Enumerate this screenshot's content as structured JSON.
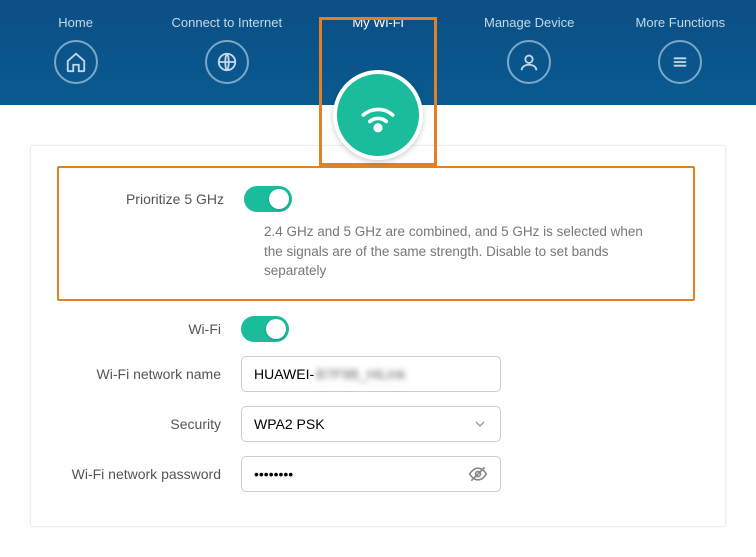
{
  "nav": {
    "home": "Home",
    "connect": "Connect to Internet",
    "wifi": "My Wi-Fi",
    "manage": "Manage Device",
    "more": "More Functions"
  },
  "form": {
    "prioritize_label": "Prioritize 5 GHz",
    "prioritize_desc": "2.4 GHz and 5 GHz are combined, and 5 GHz is selected when the signals are of the same strength. Disable to set bands separately",
    "wifi_label": "Wi-Fi",
    "ssid_label": "Wi-Fi network name",
    "ssid_value": "HUAWEI-",
    "ssid_hidden": "B7F9B_HiLink",
    "security_label": "Security",
    "security_value": "WPA2 PSK",
    "password_label": "Wi-Fi network password",
    "password_value": "••••••••"
  }
}
